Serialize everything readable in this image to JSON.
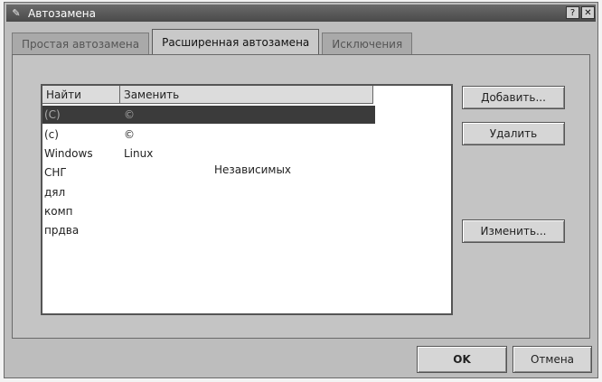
{
  "window": {
    "title": "Автозамена"
  },
  "tabs": [
    {
      "label": "Простая автозамена"
    },
    {
      "label": "Расширенная автозамена"
    },
    {
      "label": "Исключения"
    }
  ],
  "table": {
    "headers": [
      "Найти",
      "Заменить"
    ],
    "rows": [
      {
        "find": "(C)",
        "replace": "©"
      },
      {
        "find": "(c)",
        "replace": "©"
      },
      {
        "find": "Windows",
        "replace": "Linux"
      },
      {
        "find": "СНГ",
        "replace": ""
      },
      {
        "find": "дял",
        "replace": ""
      },
      {
        "find": "комп",
        "replace": ""
      },
      {
        "find": "прдва",
        "replace": ""
      }
    ],
    "selected_row": 0,
    "overflow_text": "Независимых"
  },
  "buttons": {
    "add": "Добавить...",
    "delete": "Удалить",
    "edit": "Изменить...",
    "ok": "OK",
    "cancel": "Отмена"
  },
  "icons": {
    "app": "autocorrect-icon",
    "help": "help-icon",
    "close": "close-icon"
  }
}
